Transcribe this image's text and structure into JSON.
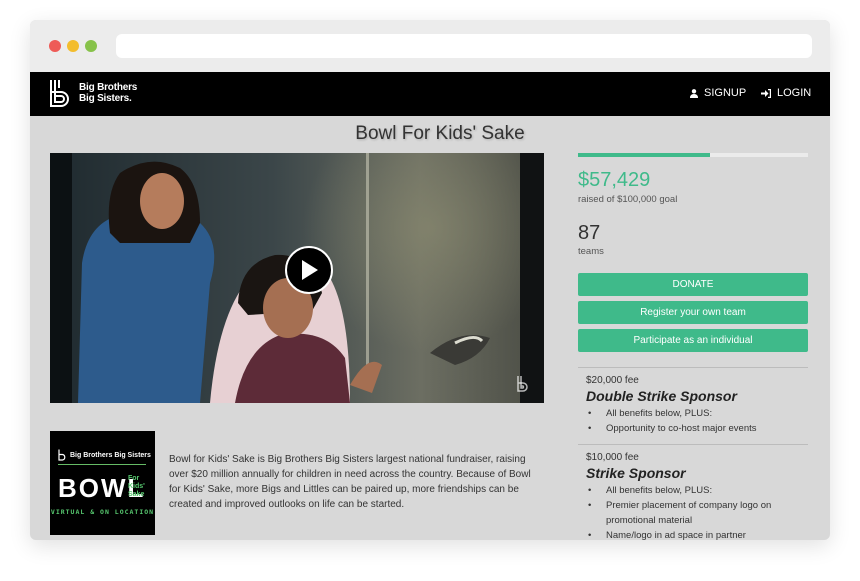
{
  "nav": {
    "logo_text": "Big Brothers\nBig Sisters.",
    "signup_label": "SIGNUP",
    "login_label": "LOGIN"
  },
  "page": {
    "title": "Bowl For Kids' Sake"
  },
  "bowl_logo": {
    "brand": "Big Brothers Big Sisters",
    "word": "BOWL",
    "sub": "For\nKids'\nSake",
    "tagline": "VIRTUAL & ON LOCATION"
  },
  "description": "Bowl for Kids' Sake is Big Brothers Big Sisters largest national fundraiser, raising over $20 million annually for children in need across the country. Because of Bowl for Kids' Sake, more Bigs and Littles can be paired up, more friendships can be created and improved outlooks on life can be started.",
  "fundraising": {
    "progress_fraction": 0.574,
    "raised": "$57,429",
    "goal_text": "raised of $100,000 goal",
    "teams_count": "87",
    "teams_label": "teams"
  },
  "buttons": {
    "donate": "DONATE",
    "register": "Register your own team",
    "individual": "Participate as an individual"
  },
  "sponsors": [
    {
      "fee": "$20,000 fee",
      "name": "Double Strike Sponsor",
      "benefits": [
        "All benefits below, PLUS:",
        "Opportunity to co-host major events"
      ]
    },
    {
      "fee": "$10,000 fee",
      "name": "Strike Sponsor",
      "benefits": [
        "All benefits below, PLUS:",
        "Premier placement of company logo on promotional material",
        "Name/logo in ad space in partner"
      ]
    }
  ],
  "colors": {
    "accent": "#3fba8a",
    "nav_bg": "#000000",
    "page_bg": "#d8d8d8"
  }
}
